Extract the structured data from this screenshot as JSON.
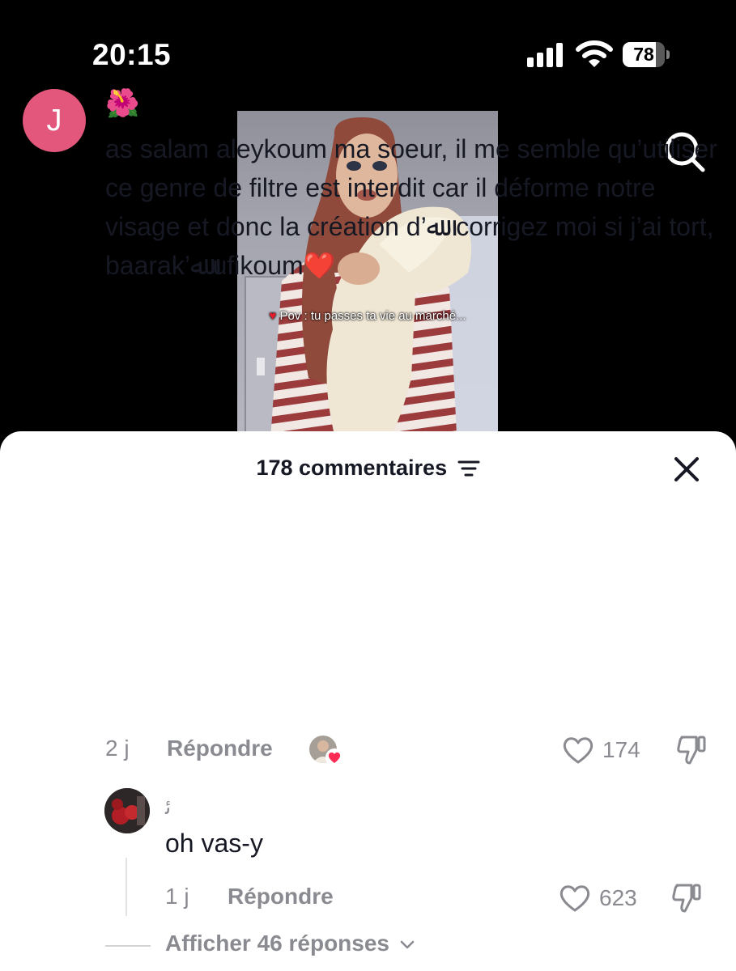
{
  "status_bar": {
    "time": "20:15",
    "battery_percent": "78",
    "battery_level": 0.78,
    "signal_bars": 4
  },
  "video": {
    "caption_emoji": "♥",
    "caption_text": "Pov : tu passes ta vie au marché..."
  },
  "comments_sheet": {
    "count_label": "178 commentaires",
    "close_icon": "close-icon",
    "filter_icon": "filter-icon",
    "comments": [
      {
        "avatar_initial": "J",
        "username": "🌺",
        "text": "as salam aleykoum ma soeur, il me semble qu’utiliser ce genre de filtre est interdit car il déforme notre visage et donc la création d’ﷲ. corrigez moi si j’ai tort, baarak’ﷲ ufikoum❤️",
        "date": "2 j",
        "reply_label": "Répondre",
        "likes": "174",
        "creator_liked": true
      }
    ],
    "replies": [
      {
        "username": "ﺋ",
        "text": "oh vas-y",
        "date": "1 j",
        "reply_label": "Répondre",
        "likes": "623"
      }
    ],
    "view_replies_label": "Afficher 46 réponses"
  },
  "colors": {
    "avatar_bg": "#e2577b",
    "text_primary": "#161823",
    "text_secondary": "#8a8b91"
  }
}
